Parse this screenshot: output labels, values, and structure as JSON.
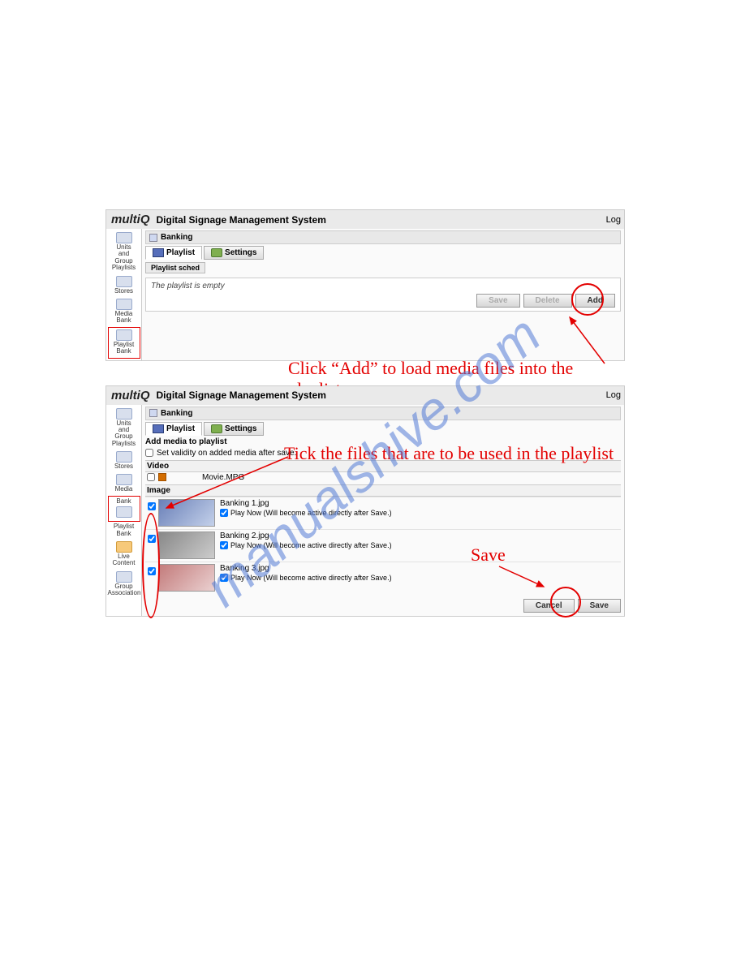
{
  "watermark": "manualshive.com",
  "app_title": "Digital Signage Management System",
  "logo_text": "multiQ",
  "header_right": "Log",
  "breadcrumb_title": "Banking",
  "tabs": {
    "playlist": "Playlist",
    "settings": "Settings"
  },
  "subtab": "Playlist sched",
  "panel1": {
    "sidebar": {
      "units": "Units\nand\nGroup\nPlaylists",
      "stores": "Stores",
      "media_bank": "Media\nBank",
      "playlist_bank": "Playlist\nBank"
    },
    "empty_msg": "The playlist is empty",
    "btn_save": "Save",
    "btn_delete": "Delete",
    "btn_add": "Add"
  },
  "anno1": "Click “Add” to load media files into the playlist",
  "panel2": {
    "sidebar": {
      "units": "Units\nand\nGroup\nPlaylists",
      "stores": "Stores",
      "media": "Media",
      "bank": "Bank",
      "playlist_bank": "Playlist\nBank",
      "live_content": "Live\nContent",
      "group_assoc": "Group\nAssociation"
    },
    "add_media_hdr": "Add media to playlist",
    "set_validity": "Set validity on added media after save.",
    "cat_video": "Video",
    "video_item": "Movie.MPG",
    "cat_image": "Image",
    "items": [
      {
        "fn": "Banking 1.jpg",
        "play": "Play Now (Will become active directly after Save.)"
      },
      {
        "fn": "Banking 2.jpg",
        "play": "Play Now (Will become active directly after Save.)"
      },
      {
        "fn": "Banking 3.jpg",
        "play": "Play Now (Will become active directly after Save.)"
      }
    ],
    "btn_cancel": "Cancel",
    "btn_save": "Save"
  },
  "anno2": "Tick the files that are to be used in the playlist",
  "anno3": "Save"
}
